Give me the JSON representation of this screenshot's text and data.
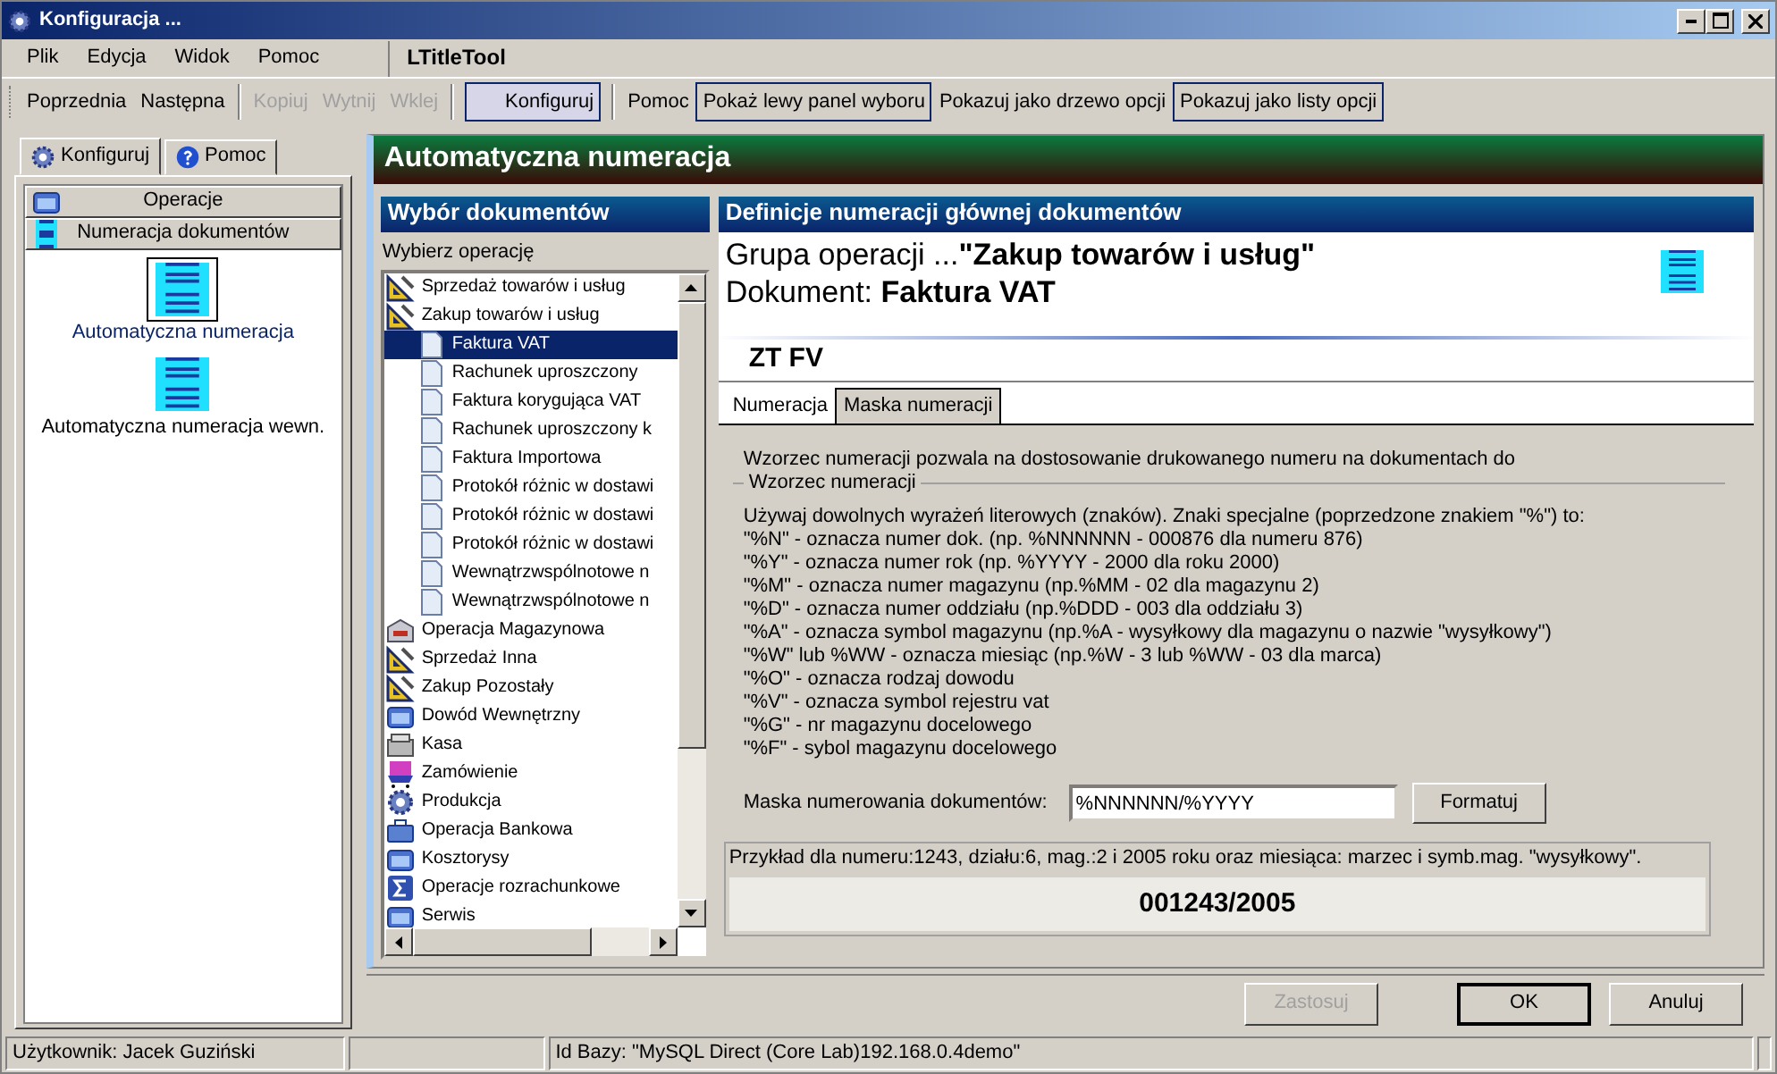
{
  "window": {
    "title": "Konfiguracja ..."
  },
  "menu": [
    "Plik",
    "Edycja",
    "Widok",
    "Pomoc"
  ],
  "menu_title": "LTitleTool",
  "toolbar": [
    {
      "kind": "button",
      "label": "Poprzednia",
      "disabled": false,
      "pressed": false
    },
    {
      "kind": "button",
      "label": "Następna",
      "disabled": false,
      "pressed": false
    },
    {
      "kind": "separator"
    },
    {
      "kind": "button",
      "label": "Kopiuj",
      "disabled": true,
      "pressed": false
    },
    {
      "kind": "button",
      "label": "Wytnij",
      "disabled": true,
      "pressed": false
    },
    {
      "kind": "button",
      "label": "Wklej",
      "disabled": true,
      "pressed": false
    },
    {
      "kind": "separator"
    },
    {
      "kind": "button",
      "label": "Konfiguruj",
      "disabled": false,
      "pressed": true
    },
    {
      "kind": "separator"
    },
    {
      "kind": "button",
      "label": "Pomoc",
      "disabled": false,
      "pressed": false
    },
    {
      "kind": "button",
      "label": "Pokaż lewy panel wyboru",
      "disabled": false,
      "pressed": true
    },
    {
      "kind": "button",
      "label": "Pokazuj jako drzewo opcji",
      "disabled": false,
      "pressed": false
    },
    {
      "kind": "button",
      "label": "Pokazuj jako listy opcji",
      "disabled": false,
      "pressed": true
    }
  ],
  "left_panel": {
    "tabs": [
      {
        "label": "Konfiguruj",
        "selected": true
      },
      {
        "label": "Pomoc",
        "selected": false
      }
    ],
    "bars": [
      {
        "label": "Operacje"
      },
      {
        "label": "Numeracja dokumentów"
      }
    ],
    "items": [
      {
        "label": "Automatyczna numeracja",
        "selected": true
      },
      {
        "label": "Automatyczna numeracja wewn.",
        "selected": false
      }
    ]
  },
  "header": "Automatyczna numeracja",
  "documents": {
    "title": "Wybór dokumentów",
    "prompt": "Wybierz operację",
    "tree": [
      {
        "label": "Sprzedaż towarów i usług",
        "kind": "triangle",
        "selected": false
      },
      {
        "label": "Zakup towarów i usług",
        "kind": "triangle",
        "selected": false,
        "children": [
          {
            "label": "Faktura VAT",
            "kind": "doc",
            "selected": true
          },
          {
            "label": "Rachunek uproszczony",
            "kind": "doc",
            "selected": false
          },
          {
            "label": "Faktura korygująca VAT",
            "kind": "doc",
            "selected": false
          },
          {
            "label": "Rachunek uproszczony k",
            "kind": "doc",
            "selected": false
          },
          {
            "label": "Faktura Importowa",
            "kind": "doc",
            "selected": false
          },
          {
            "label": "Protokół różnic w dostawi",
            "kind": "doc",
            "selected": false
          },
          {
            "label": "Protokół różnic w dostawi",
            "kind": "doc",
            "selected": false
          },
          {
            "label": "Protokół różnic w dostawi",
            "kind": "doc",
            "selected": false
          },
          {
            "label": "Wewnątrzwspólnotowe n",
            "kind": "doc",
            "selected": false
          },
          {
            "label": "Wewnątrzwspólnotowe n",
            "kind": "doc",
            "selected": false
          }
        ]
      },
      {
        "label": "Operacja Magazynowa",
        "kind": "warehouse",
        "selected": false
      },
      {
        "label": "Sprzedaż Inna",
        "kind": "triangle",
        "selected": false
      },
      {
        "label": "Zakup Pozostały",
        "kind": "triangle",
        "selected": false
      },
      {
        "label": "Dowód Wewnętrzny",
        "kind": "folder",
        "selected": false
      },
      {
        "label": "Kasa",
        "kind": "cash",
        "selected": false
      },
      {
        "label": "Zamówienie",
        "kind": "cart",
        "selected": false
      },
      {
        "label": "Produkcja",
        "kind": "gear",
        "selected": false
      },
      {
        "label": "Operacja Bankowa",
        "kind": "bank",
        "selected": false
      },
      {
        "label": "Kosztorysy",
        "kind": "folder",
        "selected": false
      },
      {
        "label": "Operacje rozrachunkowe",
        "kind": "sigma",
        "selected": false
      },
      {
        "label": "Serwis",
        "kind": "folder",
        "selected": false
      }
    ]
  },
  "definition": {
    "title": "Definicje numeracji głównej dokumentów",
    "group": "Grupa operacji ...**\"Zakup towarów i usług\"**",
    "document": "Dokument: **Faktura VAT**",
    "code": "ZT FV",
    "tabs": [
      {
        "label": "Numeracja",
        "selected": false
      },
      {
        "label": "Maska numeracji",
        "selected": true
      }
    ],
    "intro": "Wzorzec numeracji pozwala na dostosowanie drukowanego numeru na dokumentach do",
    "groupbox_title": "Wzorzec numeracji",
    "rules": [
      "Używaj dowolnych wyrażeń literowych (znaków). Znaki specjalne (poprzedzone znakiem \"%\") to:",
      "\"%N\" - oznacza numer dok. (np. %NNNNNN - 000876 dla numeru 876)",
      "\"%Y\" - oznacza numer rok (np. %YYYY - 2000 dla roku 2000)",
      "\"%M\" - oznacza numer magazynu (np.%MM - 02 dla magazynu 2)",
      "\"%D\" - oznacza numer oddziału (np.%DDD - 003 dla oddziału 3)",
      "\"%A\" - oznacza symbol magazynu (np.%A - wysyłkowy dla magazynu o nazwie \"wysyłkowy\")",
      "\"%W\" lub %WW - oznacza miesiąc (np.%W - 3 lub %WW - 03 dla marca)",
      "\"%O\" - oznacza rodzaj dowodu",
      "\"%V\" - oznacza symbol rejestru vat",
      "\"%G\" - nr magazynu docelowego",
      "\"%F\" - sybol magazynu docelowego"
    ],
    "mask_label": "Maska numerowania dokumentów:",
    "mask_value": "%NNNNNN/%YYYY",
    "format_button": "Formatuj",
    "example_text": "Przykład dla numeru:1243, działu:6, mag.:2 i 2005 roku oraz miesiąca: marzec i symb.mag. \"wysyłkowy\".",
    "example_result": "001243/2005"
  },
  "buttons": [
    {
      "label": "Zastosuj",
      "disabled": true,
      "default": false
    },
    {
      "label": "OK",
      "disabled": false,
      "default": true
    },
    {
      "label": "Anuluj",
      "disabled": false,
      "default": false
    }
  ],
  "status_bar": [
    "Użytkownik: Jacek Guziński",
    "Id Bazy: \"MySQL Direct (Core Lab)192.168.0.4demo\""
  ]
}
